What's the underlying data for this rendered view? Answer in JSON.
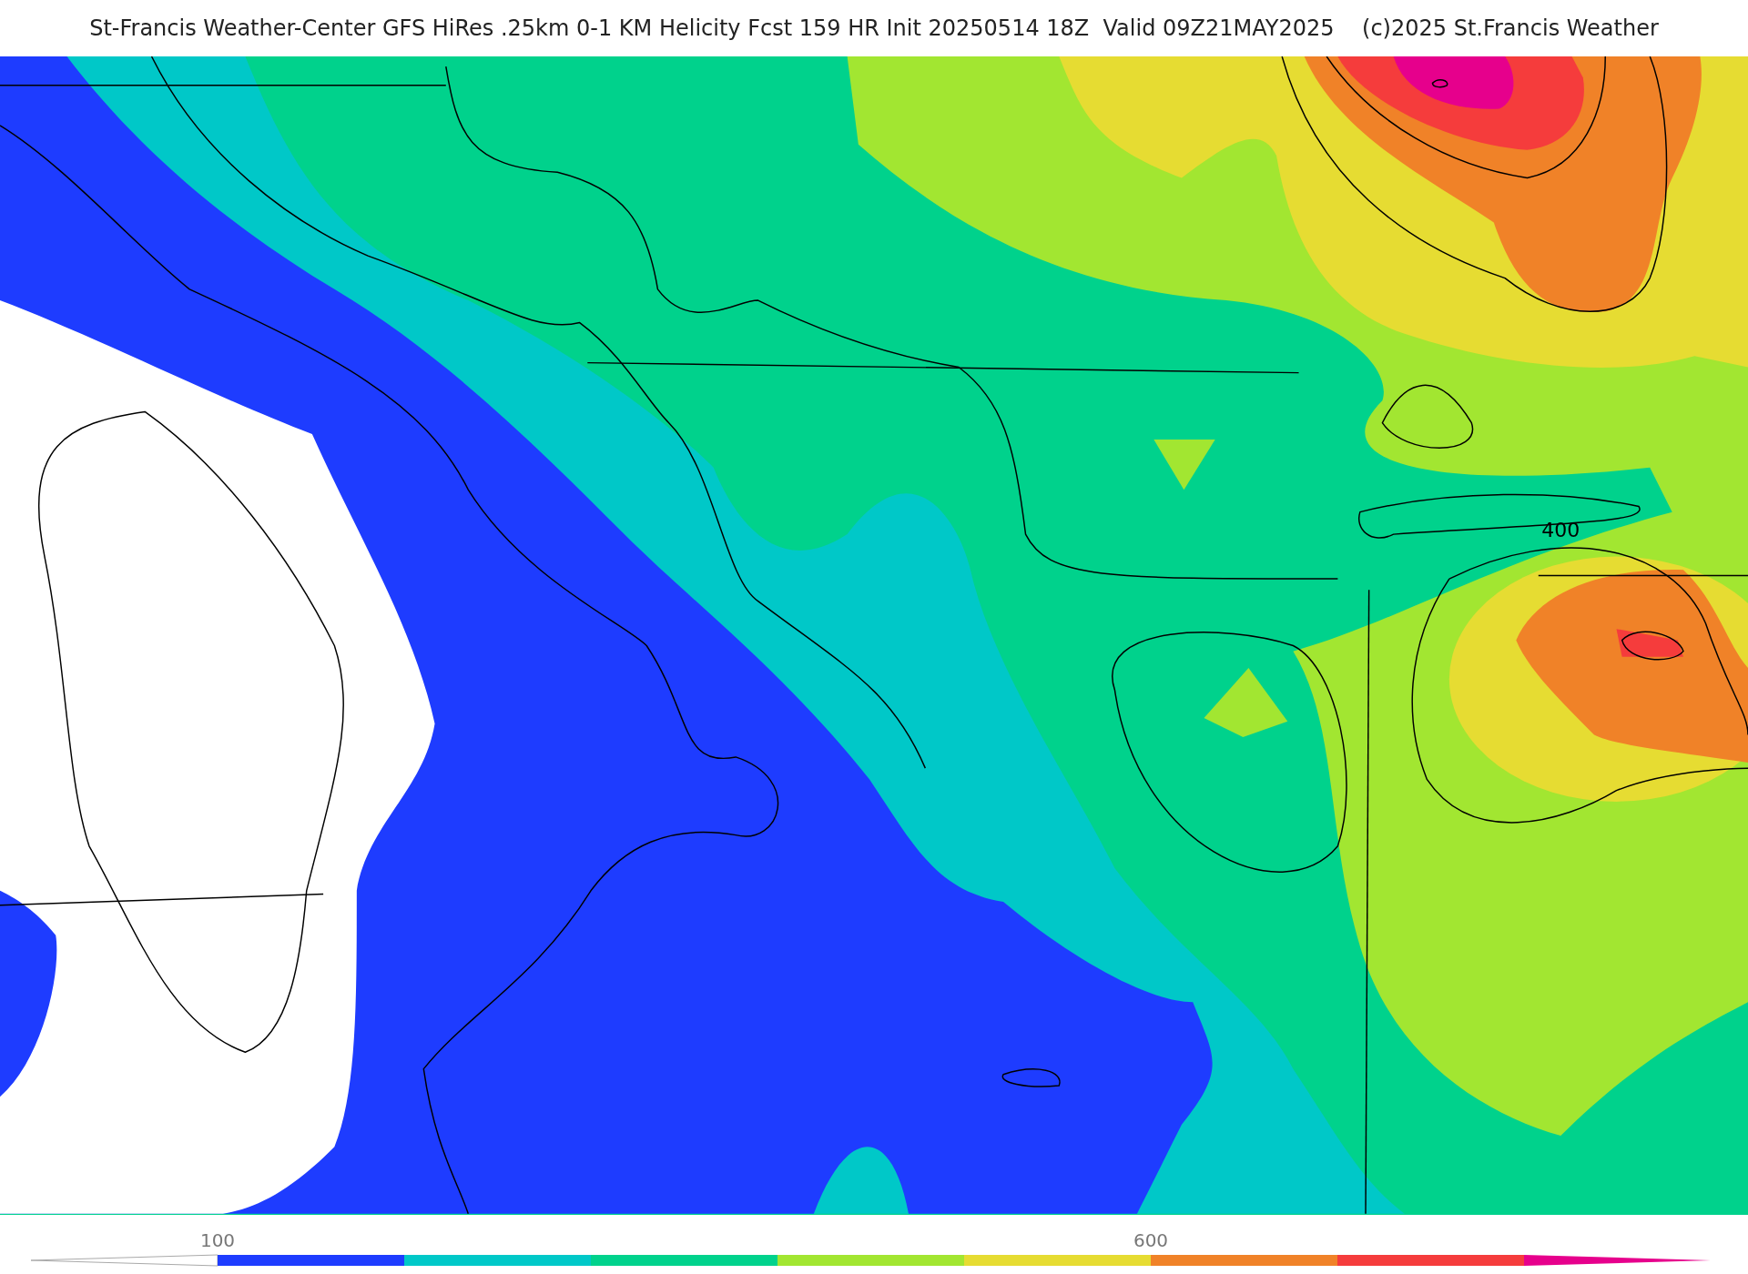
{
  "title": "St-Francis Weather-Center GFS HiRes .25km 0-1 KM Helicity Fcst 159 HR Init 20250514 18Z  Valid 09Z21MAY2025    (c)2025 St.Francis Weather",
  "map": {
    "contour_label": "400"
  },
  "colorbar": {
    "segments": [
      {
        "color": "#1e3cff"
      },
      {
        "color": "#00c8c8"
      },
      {
        "color": "#00d28c"
      },
      {
        "color": "#a2e631"
      },
      {
        "color": "#e6dc32"
      },
      {
        "color": "#f08228"
      },
      {
        "color": "#f53c3c"
      },
      {
        "color": "#e6008c"
      }
    ],
    "labels": [
      {
        "text": "100"
      },
      {
        "text": "600"
      }
    ]
  }
}
